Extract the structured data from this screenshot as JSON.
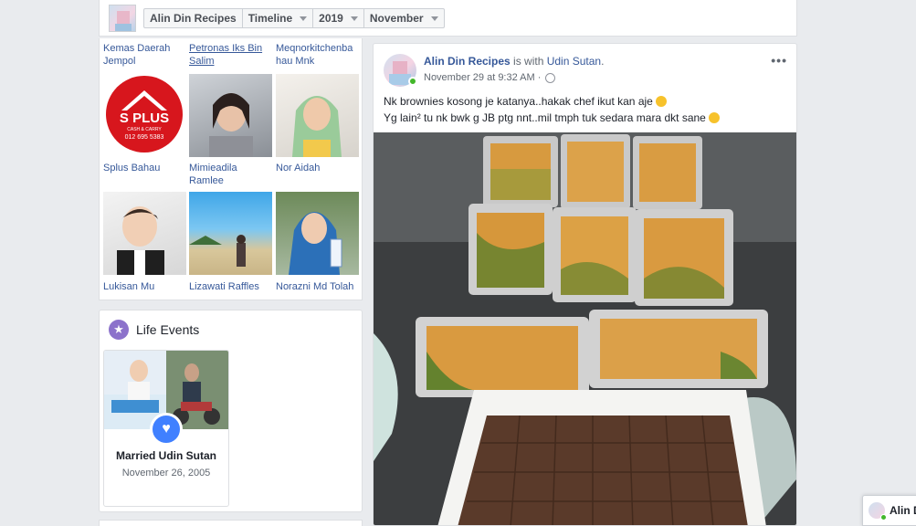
{
  "nav": {
    "page_name": "Alin Din Recipes",
    "timeline_label": "Timeline",
    "year_label": "2019",
    "month_label": "November"
  },
  "friends": [
    {
      "name": "Kemas Daerah Jempol"
    },
    {
      "name": "Petronas Iks Bin Salim"
    },
    {
      "name": "Meqnorkitchenba hau Mnk"
    },
    {
      "name": "Splus Bahau"
    },
    {
      "name": "Mimieadila Ramlee"
    },
    {
      "name": "Nor Aidah"
    },
    {
      "name": "Lukisan Mu"
    },
    {
      "name": "Lizawati Raffles"
    },
    {
      "name": "Norazni Md Tolah"
    }
  ],
  "splus_logo": {
    "brand": "S PLUS",
    "tagline": "CASH & CARRY",
    "phone": "012 695 5383"
  },
  "life_events": {
    "title": "Life Events",
    "event_title": "Married Udin Sutan",
    "event_date": "November 26, 2005"
  },
  "post": {
    "author": "Alin Din Recipes",
    "with_text": " is with ",
    "tagged": "Udin Sutan",
    "tagged_suffix": ".",
    "timestamp": "November 29 at 9:32 AM · ",
    "line1": "Nk brownies kosong je katanya..hakak chef ikut kan aje",
    "line2": "Yg lain² tu nk bwk g JB ptg nnt..mil tmph tuk sedara mara dkt sane",
    "more_label": "•••"
  },
  "chat": {
    "name": "Alin D"
  },
  "colors": {
    "link": "#365899",
    "accent": "#4080ff",
    "online": "#42b72a",
    "life_star": "#8c72cb"
  }
}
